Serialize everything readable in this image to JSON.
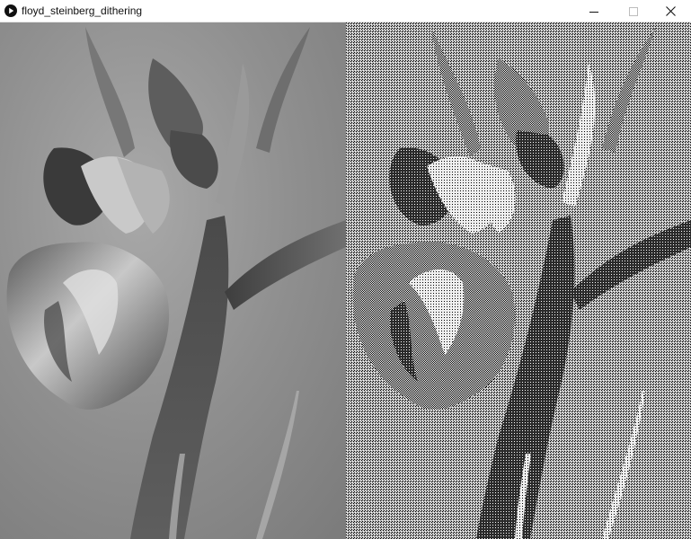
{
  "window": {
    "title": "floyd_steinberg_dithering",
    "app_icon": "processing-play-icon",
    "controls": [
      "minimize-icon",
      "maximize-icon",
      "close-icon"
    ]
  },
  "sketch": {
    "panels": [
      {
        "name": "original-grayscale",
        "subject": "iris flower",
        "tone": "continuous gray"
      },
      {
        "name": "dithered-output",
        "subject": "iris flower",
        "tone": "black and white dot pattern"
      }
    ],
    "colors": {
      "background_gray": "#8a8a8a",
      "dark": "#333333",
      "light": "#d8d8d8"
    }
  }
}
